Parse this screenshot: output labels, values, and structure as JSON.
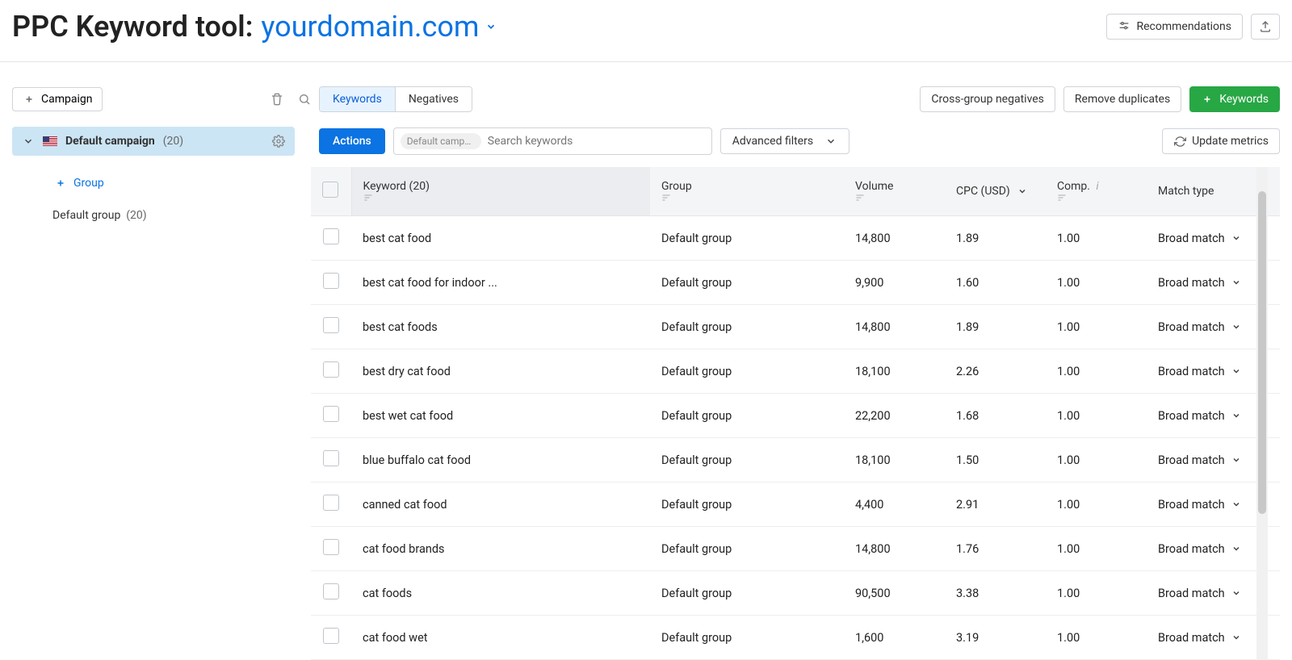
{
  "header": {
    "title_prefix": "PPC Keyword tool:",
    "domain": "yourdomain.com",
    "recommendations_label": "Recommendations"
  },
  "sidebar_toolbar": {
    "add_campaign_label": "Campaign"
  },
  "tabs": {
    "keywords": "Keywords",
    "negatives": "Negatives"
  },
  "right_toolbar": {
    "cross_group": "Cross-group negatives",
    "remove_dup": "Remove duplicates",
    "keywords_btn": "Keywords"
  },
  "campaign": {
    "name": "Default campaign",
    "count": "(20)"
  },
  "filter_bar": {
    "actions": "Actions",
    "chip": "Default campaign",
    "search_placeholder": "Search keywords",
    "advanced": "Advanced filters",
    "update": "Update metrics"
  },
  "sidebar": {
    "add_group": "Group",
    "group_name": "Default group",
    "group_count": "(20)"
  },
  "columns": {
    "keyword": "Keyword (20)",
    "group": "Group",
    "volume": "Volume",
    "cpc": "CPC (USD)",
    "comp": "Comp.",
    "match": "Match type"
  },
  "match_label": "Broad match",
  "rows": [
    {
      "keyword": "best cat food",
      "group": "Default group",
      "volume": "14,800",
      "cpc": "1.89",
      "comp": "1.00"
    },
    {
      "keyword": "best cat food for indoor ...",
      "group": "Default group",
      "volume": "9,900",
      "cpc": "1.60",
      "comp": "1.00"
    },
    {
      "keyword": "best cat foods",
      "group": "Default group",
      "volume": "14,800",
      "cpc": "1.89",
      "comp": "1.00"
    },
    {
      "keyword": "best dry cat food",
      "group": "Default group",
      "volume": "18,100",
      "cpc": "2.26",
      "comp": "1.00"
    },
    {
      "keyword": "best wet cat food",
      "group": "Default group",
      "volume": "22,200",
      "cpc": "1.68",
      "comp": "1.00"
    },
    {
      "keyword": "blue buffalo cat food",
      "group": "Default group",
      "volume": "18,100",
      "cpc": "1.50",
      "comp": "1.00"
    },
    {
      "keyword": "canned cat food",
      "group": "Default group",
      "volume": "4,400",
      "cpc": "2.91",
      "comp": "1.00"
    },
    {
      "keyword": "cat food brands",
      "group": "Default group",
      "volume": "14,800",
      "cpc": "1.76",
      "comp": "1.00"
    },
    {
      "keyword": "cat foods",
      "group": "Default group",
      "volume": "90,500",
      "cpc": "3.38",
      "comp": "1.00"
    },
    {
      "keyword": "cat food wet",
      "group": "Default group",
      "volume": "1,600",
      "cpc": "3.19",
      "comp": "1.00"
    }
  ]
}
